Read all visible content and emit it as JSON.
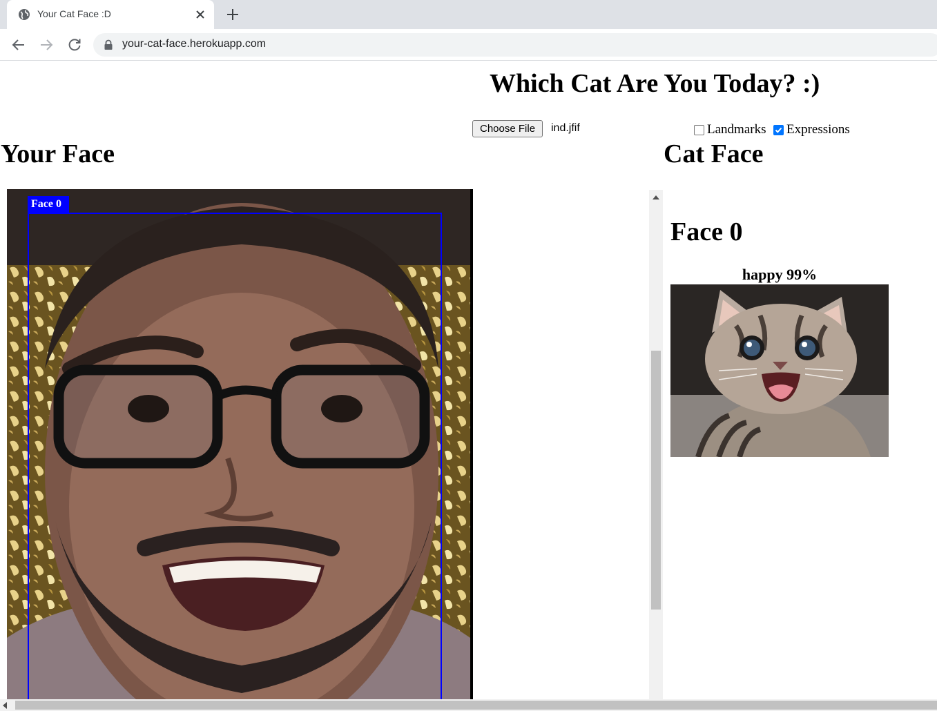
{
  "browser": {
    "tab_title": "Your Cat Face :D",
    "url": "your-cat-face.herokuapp.com"
  },
  "page": {
    "title": "Which Cat Are You Today? :)",
    "file_button_label": "Choose File",
    "file_name": "ind.jfif",
    "options": [
      {
        "label": "Landmarks",
        "checked": false
      },
      {
        "label": "Expressions",
        "checked": true
      }
    ],
    "your_face_heading": "Your Face",
    "cat_face_heading": "Cat Face",
    "detections": [
      {
        "tag": "Face 0"
      }
    ],
    "results": [
      {
        "title": "Face 0",
        "expression": "happy 99%"
      }
    ]
  }
}
